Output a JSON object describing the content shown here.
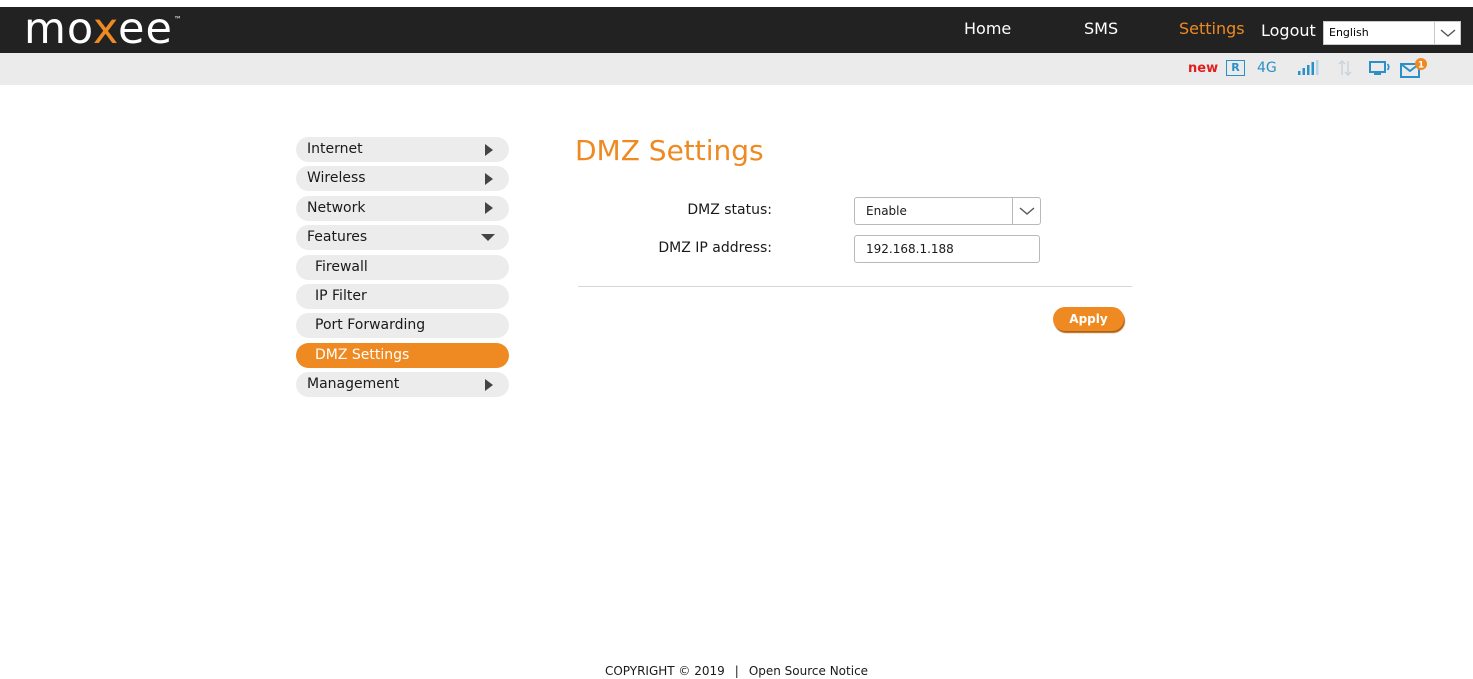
{
  "header": {
    "logo": {
      "prefix": "mo",
      "accent": "x",
      "suffix": "ee",
      "tm": "™"
    },
    "nav": {
      "home": "Home",
      "sms": "SMS",
      "settings": "Settings",
      "logout": "Logout"
    },
    "language": {
      "selected": "English"
    }
  },
  "status": {
    "new_label": "new",
    "roaming": "R",
    "network": "4G",
    "mail_count": "1",
    "icons": [
      "roaming-icon",
      "signal-icon",
      "data-transfer-icon",
      "connected-device-icon",
      "mail-icon"
    ]
  },
  "sidebar": {
    "items": [
      {
        "label": "Internet"
      },
      {
        "label": "Wireless"
      },
      {
        "label": "Network"
      },
      {
        "label": "Features"
      },
      {
        "label": "Firewall"
      },
      {
        "label": "IP Filter"
      },
      {
        "label": "Port Forwarding"
      },
      {
        "label": "DMZ Settings"
      },
      {
        "label": "Management"
      }
    ]
  },
  "main": {
    "title": "DMZ Settings",
    "status_label": "DMZ status:",
    "status_value": "Enable",
    "ip_label": "DMZ IP address:",
    "ip_value": "192.168.1.188",
    "apply_label": "Apply"
  },
  "footer": {
    "copyright": "COPYRIGHT © 2019",
    "separator": "|",
    "notice": "Open Source Notice"
  },
  "colors": {
    "accent": "#ef8a22",
    "header_bg": "#222222",
    "status_bg": "#ebebeb",
    "status_blue": "#2a90c7",
    "new_red": "#e0201e"
  }
}
